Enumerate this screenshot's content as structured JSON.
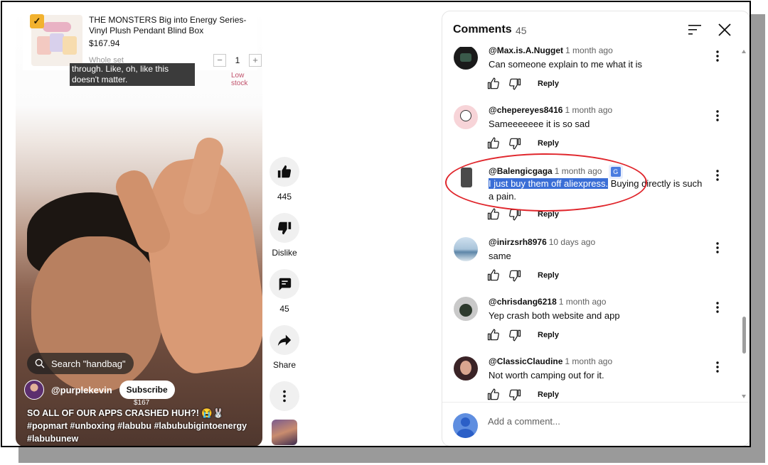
{
  "product": {
    "title": "THE MONSTERS Big into Energy Series-Vinyl Plush Pendant Blind Box",
    "price": "$167.94",
    "variant": "Whole set",
    "quantity": "1",
    "minus": "−",
    "plus": "+",
    "stock_status": "Low stock",
    "check_mark": "✓"
  },
  "video": {
    "live_caption": "through. Like, oh, like this doesn't matter.",
    "search_chip": "Search \"handbag\"",
    "channel_handle": "@purplekevin",
    "subscribe_label": "Subscribe",
    "price_overlay": "$167",
    "description": "SO ALL OF OUR APPS CRASHED HUH?! 😭🐰 #popmart #unboxing #labubu #labububigintoenergy #labubunew"
  },
  "actions": {
    "like_count": "445",
    "dislike_label": "Dislike",
    "comment_count": "45",
    "share_label": "Share"
  },
  "comments_panel": {
    "title": "Comments",
    "count": "45",
    "reply_label": "Reply",
    "add_placeholder": "Add a comment...",
    "items": [
      {
        "author": "@Max.is.A.Nugget",
        "time": "1 month ago",
        "text": "Can someone explain to me what it is"
      },
      {
        "author": "@chepereyes8416",
        "time": "1 month ago",
        "text": "Sameeeeeee it is so sad"
      },
      {
        "author": "@Balengicgaga",
        "time": "1 month ago",
        "text_highlight": "I just buy them off aliexpress.",
        "text_rest": " Buying directly is such a pain."
      },
      {
        "author": "@inirzsrh8976",
        "time": "10 days ago",
        "text": "same"
      },
      {
        "author": "@chrisdang6218",
        "time": "1 month ago",
        "text": "Yep crash both website and app"
      },
      {
        "author": "@ClassicClaudine",
        "time": "1 month ago",
        "text": "Not worth camping out for it."
      }
    ]
  },
  "icons": {
    "translate": "translate-icon",
    "sort": "sort-icon",
    "close": "close-icon",
    "like": "thumbs-up-icon",
    "dislike": "thumbs-down-icon",
    "more": "more-vert-icon"
  },
  "colors": {
    "highlight": "#3a6ed6",
    "annotation_circle": "#e0262c",
    "check_badge": "#f2b22f",
    "low_stock": "#c0506a"
  }
}
